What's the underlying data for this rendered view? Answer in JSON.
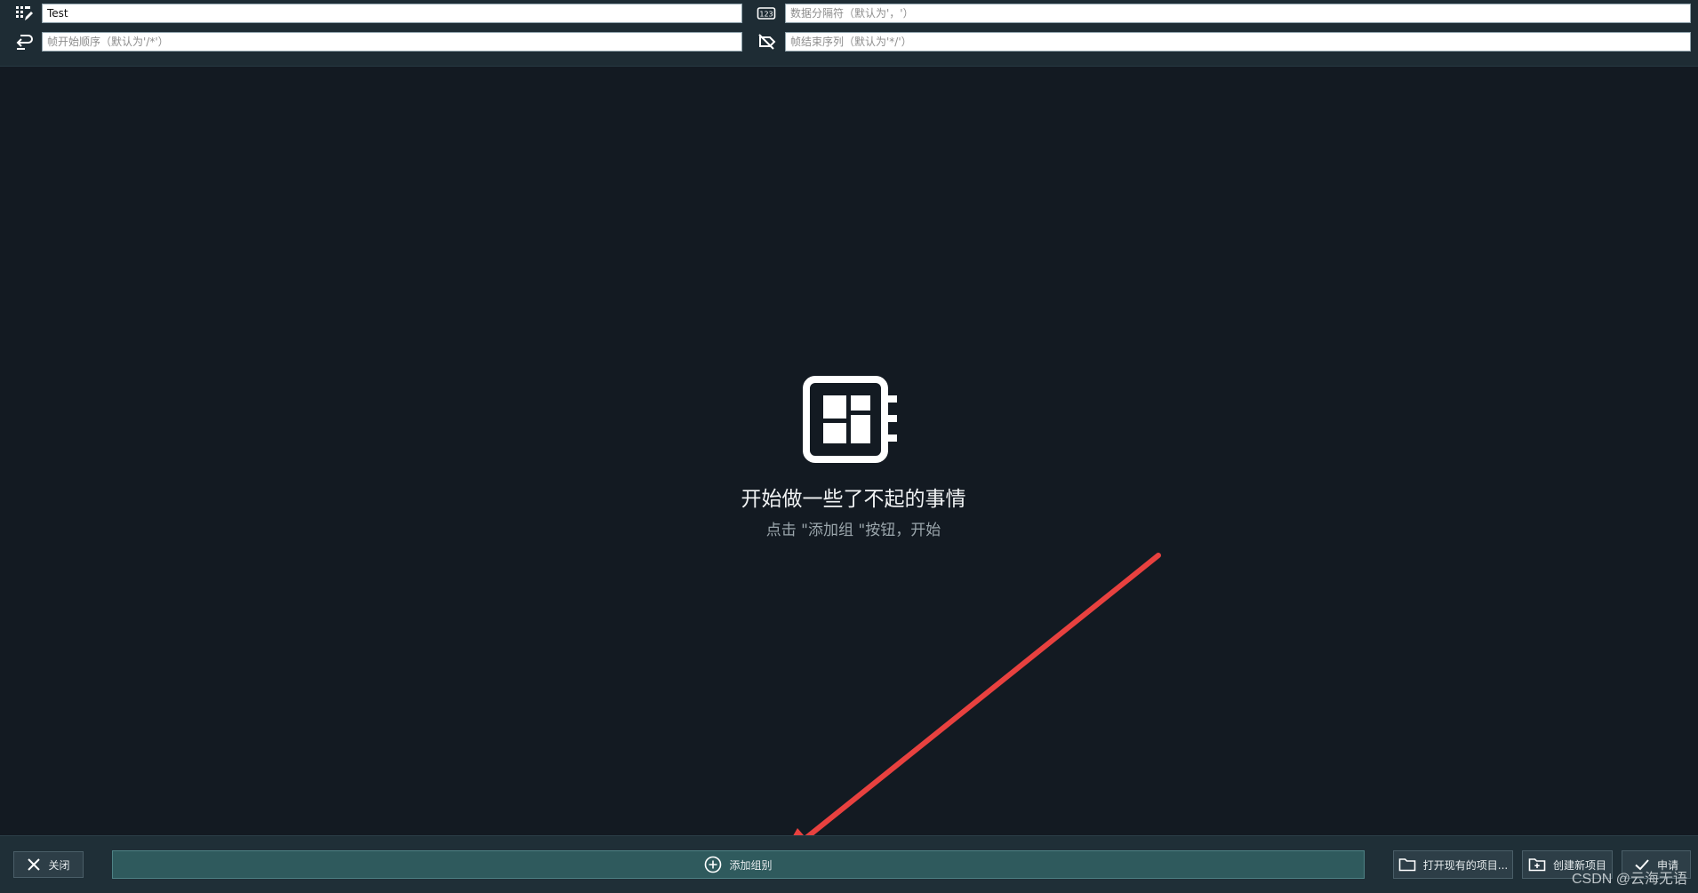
{
  "settings": {
    "name_value": "Test",
    "data_separator_placeholder": "数据分隔符（默认为'，'）",
    "frame_start_placeholder": "帧开始顺序（默认为'/*'）",
    "frame_end_placeholder": "帧结束序列（默认为'*/'）",
    "icons": [
      "edit-list-icon",
      "number-123-icon",
      "return-arrow-icon",
      "tag-off-icon"
    ]
  },
  "empty_state": {
    "icon": "dashboard-panel-icon",
    "title": "开始做一些了不起的事情",
    "subtitle": "点击 \"添加组 \"按钮，开始"
  },
  "footer": {
    "close_label": "关闭",
    "add_group_label": "添加组别",
    "open_project_label": "打开现有的项目...",
    "new_project_label": "创建新项目",
    "apply_label": "申请"
  },
  "watermark": "CSDN @云海无语",
  "colors": {
    "background": "#131a22",
    "bar": "#1e2c34",
    "accent_button": "#2f5a5d",
    "annotation_arrow": "#e8413f"
  }
}
